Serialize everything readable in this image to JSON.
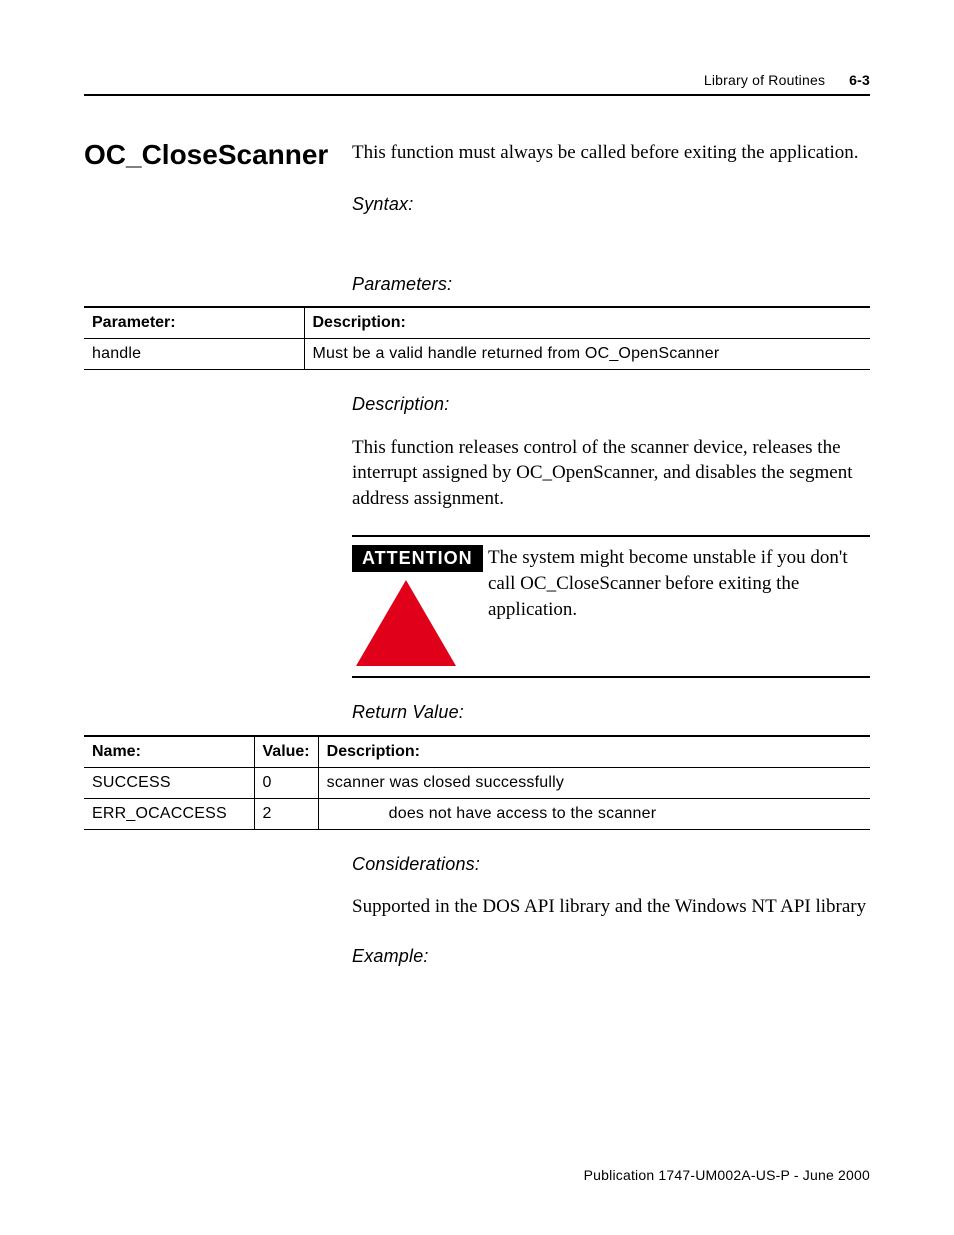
{
  "running_head": {
    "chapter": "Library of Routines",
    "page": "6-3"
  },
  "section_title": "OC_CloseScanner",
  "intro": "This function must always be called before exiting the application.",
  "labels": {
    "syntax": "Syntax:",
    "parameters": "Parameters:",
    "description": "Description:",
    "return_value": "Return Value:",
    "considerations": "Considerations:",
    "example": "Example:"
  },
  "params_table": {
    "headers": {
      "parameter": "Parameter:",
      "description": "Description:"
    },
    "rows": [
      {
        "parameter": "handle",
        "description": "Must be a valid handle returned from OC_OpenScanner"
      }
    ]
  },
  "description_text": "This function releases control of the scanner device, releases the interrupt assigned by OC_OpenScanner, and disables the segment address assignment.",
  "attention": {
    "badge": "ATTENTION",
    "text": "The system might become unstable if you don't call OC_CloseScanner before exiting the application."
  },
  "returns_table": {
    "headers": {
      "name": "Name:",
      "value": "Value:",
      "description": "Description:"
    },
    "rows": [
      {
        "name": "SUCCESS",
        "value": "0",
        "description": "scanner was closed successfully"
      },
      {
        "name": "ERR_OCACCESS",
        "value": "2",
        "description": "does not have access to the scanner"
      }
    ]
  },
  "considerations_text": "Supported in the DOS API library and the Windows NT API library",
  "footer": "Publication 1747-UM002A-US-P - June 2000"
}
